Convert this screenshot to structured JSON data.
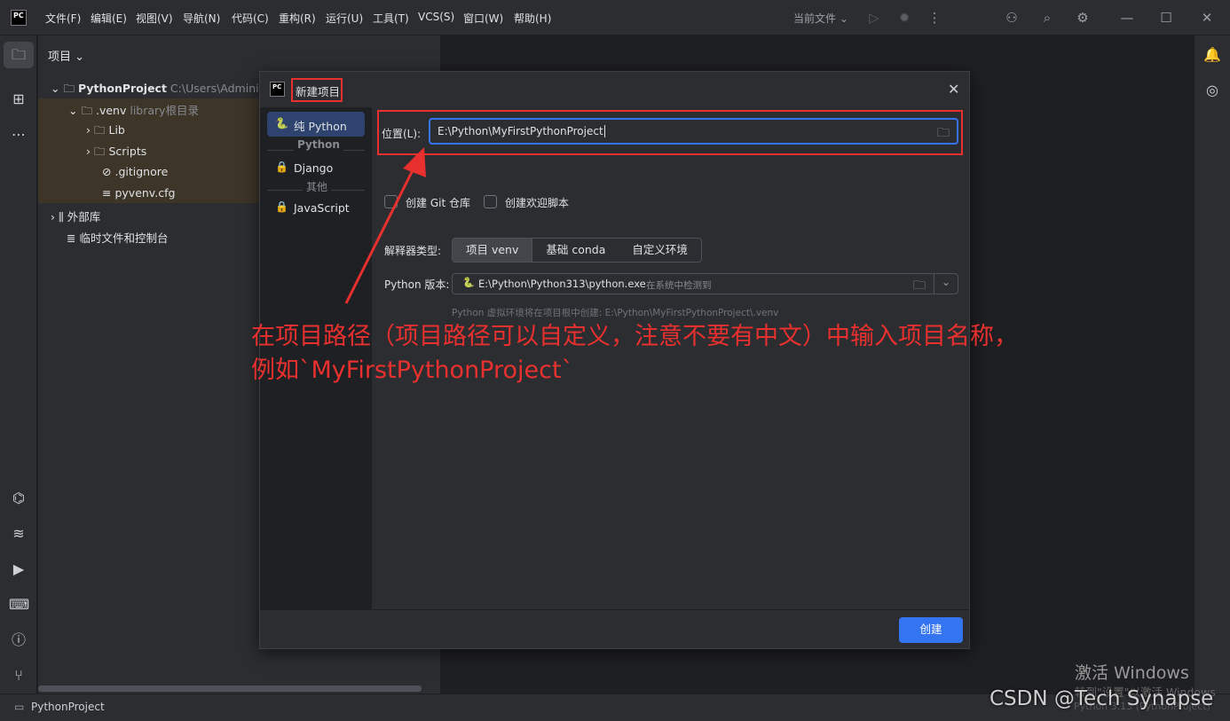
{
  "topbar": {
    "menus": [
      "文件(F)",
      "编辑(E)",
      "视图(V)",
      "导航(N)",
      "代码(C)",
      "重构(R)",
      "运行(U)",
      "工具(T)",
      "VCS(S)",
      "窗口(W)",
      "帮助(H)"
    ],
    "run_config": "当前文件",
    "logo_text": "PC"
  },
  "project_panel": {
    "title": "项目",
    "root_name": "PythonProject",
    "root_path": "C:\\Users\\Administ",
    "venv": ".venv",
    "venv_note": "library根目录",
    "items": [
      "Lib",
      "Scripts",
      ".gitignore",
      "pyvenv.cfg"
    ],
    "external_libs": "外部库",
    "scratches": "临时文件和控制台"
  },
  "dialog": {
    "title": "新建项目",
    "sidebar": {
      "selected": "纯 Python",
      "section_python": "Python",
      "django": "Django",
      "section_other": "其他",
      "javascript": "JavaScript"
    },
    "location_label": "位置(L):",
    "location_value": "E:\\Python\\MyFirstPythonProject",
    "git_checkbox": "创建 Git 仓库",
    "welcome_checkbox": "创建欢迎脚本",
    "interpreter_label": "解释器类型:",
    "interpreter_options": [
      "项目 venv",
      "基础 conda",
      "自定义环境"
    ],
    "python_version_label": "Python 版本:",
    "python_path": "E:\\Python\\Python313\\python.exe",
    "python_detected": "在系统中检测到",
    "hint": "Python 虚拟环境将在项目根中创建: E:\\Python\\MyFirstPythonProject\\.venv",
    "create_button": "创建"
  },
  "annotation": {
    "line1": "在项目路径（项目路径可以自定义，注意不要有中文）中输入项目名称，",
    "line2": "例如`MyFirstPythonProject`"
  },
  "statusbar": {
    "project": "PythonProject"
  },
  "watermark": {
    "activate": "激活 Windows",
    "activate_sub": "转到\"设置\"以激活 Windows",
    "csdn": "CSDN @Tech Synapse",
    "faint": "Python 3.13 (PythonProject)"
  },
  "colors": {
    "accent": "#3574f0",
    "annotation_red": "#e8302f",
    "bg": "#2b2d30"
  }
}
